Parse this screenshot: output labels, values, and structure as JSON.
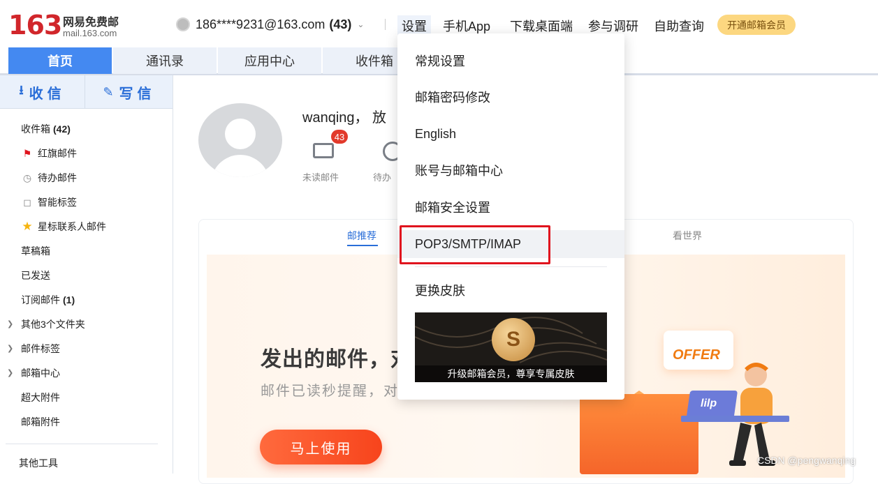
{
  "header": {
    "logo_number": "163",
    "logo_cn": "网易免费邮",
    "logo_domain": "mail.163.com",
    "account_email": "186****9231@163.com",
    "account_count": "(43)",
    "nav": {
      "settings": "设置",
      "mobile_app": "手机App",
      "desktop": "下载桌面端",
      "survey": "参与调研",
      "self_query": "自助查询"
    },
    "vip_button": "开通邮箱会员"
  },
  "tabs": {
    "home": "首页",
    "contacts": "通讯录",
    "apps": "应用中心",
    "inbox": "收件箱"
  },
  "sidebar": {
    "receive": "收信",
    "write": "写信",
    "folders": {
      "inbox": "收件箱",
      "inbox_count": "(42)",
      "red_flag": "红旗邮件",
      "todo": "待办邮件",
      "smart_tags": "智能标签",
      "starred": "星标联系人邮件",
      "drafts": "草稿箱",
      "sent": "已发送",
      "subscriptions": "订阅邮件",
      "subscriptions_count": "(1)",
      "other_folders": "其他3个文件夹",
      "mail_tags": "邮件标签",
      "mail_center": "邮箱中心",
      "large_attachments": "超大附件",
      "attachments": "邮箱附件",
      "other_tools": "其他工具"
    }
  },
  "main": {
    "greeting": "wanqing， 放",
    "unread_count": "43",
    "unread_label": "未读邮件",
    "todo_label": "待办",
    "tab_recommend": "邮推荐",
    "tab_world": "看世界",
    "banner_title": "发出的邮件，对",
    "banner_subtitle": "邮件已读秒提醒，对",
    "banner_button": "马上使用",
    "offer_text": "OFFER",
    "laptop_logo": "lilp"
  },
  "settings_menu": {
    "general": "常规设置",
    "password": "邮箱密码修改",
    "english": "English",
    "account_center": "账号与邮箱中心",
    "security": "邮箱安全设置",
    "pop3": "POP3/SMTP/IMAP",
    "skin": "更换皮肤",
    "skin_promo": "升级邮箱会员，尊享专属皮肤",
    "coin_symbol": "S"
  },
  "watermark": "CSDN @pengwanqing",
  "colors": {
    "brand_red": "#d1262b",
    "tab_active": "#4489f1",
    "link_blue": "#2a6ed8",
    "highlight_border": "#e0141e",
    "cta_orange": "#f7441c"
  }
}
